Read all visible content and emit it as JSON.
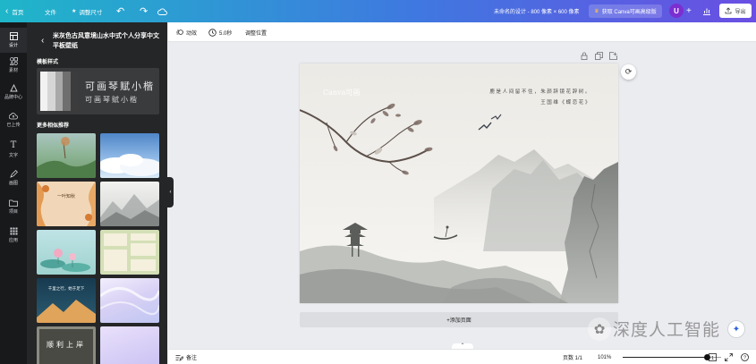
{
  "topbar": {
    "back_label": "首页",
    "file_label": "文件",
    "resize_label": "调整尺寸",
    "status": "未命名的设计 - 800 像素 × 600 像素",
    "pro_label": "获取 Canva可画高级版",
    "avatar_initial": "U",
    "export_label": "导出"
  },
  "rail": {
    "items": [
      {
        "label": "设计",
        "icon": "layout-icon"
      },
      {
        "label": "素材",
        "icon": "shapes-icon"
      },
      {
        "label": "品牌中心",
        "icon": "brand-icon"
      },
      {
        "label": "已上传",
        "icon": "upload-icon"
      },
      {
        "label": "文字",
        "icon": "text-icon"
      },
      {
        "label": "画图",
        "icon": "draw-icon"
      },
      {
        "label": "项目",
        "icon": "folder-icon"
      },
      {
        "label": "应用",
        "icon": "apps-icon"
      }
    ]
  },
  "panel": {
    "title": "米灰色古风意境山水中式个人分享中文平板壁纸",
    "font_section": "模板样式",
    "font_sample_1": "可画琴赋小楷",
    "font_sample_2": "可画琴赋小楷",
    "more_section": "更多相似推荐",
    "tile_texts": [
      "一叶知秋",
      "千里之行，始于足下",
      "顺利上岸"
    ]
  },
  "editor_toolbar": {
    "animate_label": "动效",
    "duration_label": "5.0秒",
    "position_label": "调整位置"
  },
  "canvas": {
    "logo": "Canva可画",
    "poem_line1": "鹿是人间留不住，朱颜辞镜花辞树。",
    "poem_line2": "王国维《蝶恋花》",
    "add_page_label": "+添加页面"
  },
  "bottombar": {
    "notes_label": "备注",
    "page_label": "页数 1/1",
    "zoom_label": "101%",
    "zoom_fraction": 0.86
  },
  "watermark": {
    "text": "深度人工智能"
  },
  "colors": {
    "topbar_start": "#1fb6c9",
    "topbar_end": "#6a4fe3",
    "avatar": "#7b2fd0",
    "rail_bg": "#18191b",
    "panel_bg": "#252627",
    "canvas_bg": "#ebecf0"
  }
}
